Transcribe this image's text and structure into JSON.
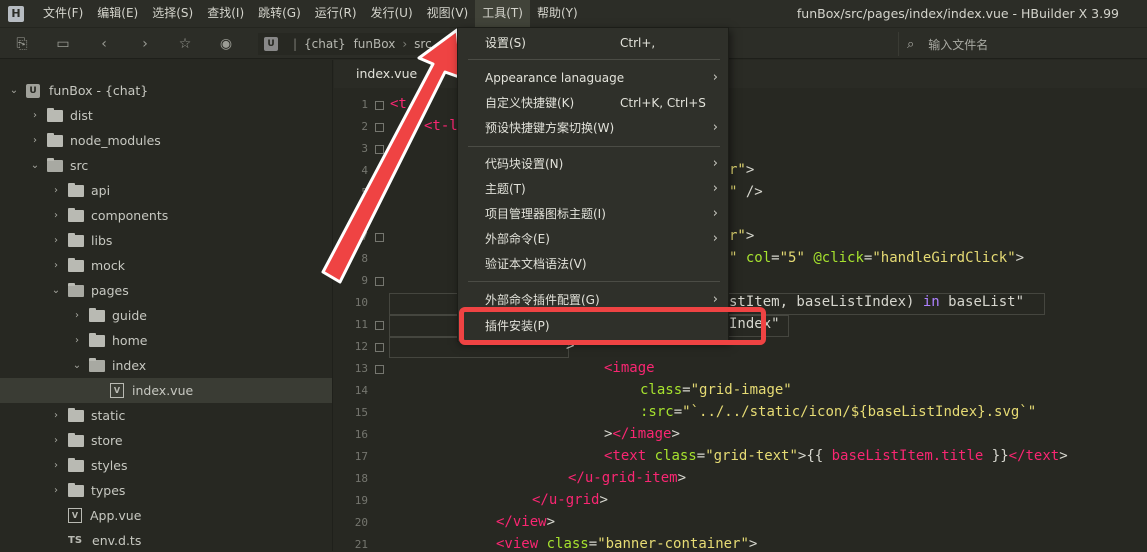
{
  "menubar": {
    "items": [
      "文件(F)",
      "编辑(E)",
      "选择(S)",
      "查找(I)",
      "跳转(G)",
      "运行(R)",
      "发行(U)",
      "视图(V)",
      "工具(T)",
      "帮助(Y)"
    ],
    "active_index": 8,
    "window_title": "funBox/src/pages/index/index.vue - HBuilder X 3.99"
  },
  "toolbar": {
    "breadcrumb": [
      "{chat}",
      "funBox",
      "src"
    ],
    "file_search_placeholder": "输入文件名"
  },
  "sidebar": {
    "project_name": "funBox - {chat}",
    "items": [
      {
        "label": "dist",
        "type": "folder",
        "depth": 1,
        "expanded": false
      },
      {
        "label": "node_modules",
        "type": "folder",
        "depth": 1,
        "expanded": false
      },
      {
        "label": "src",
        "type": "folder",
        "depth": 1,
        "expanded": true
      },
      {
        "label": "api",
        "type": "folder",
        "depth": 2,
        "expanded": false
      },
      {
        "label": "components",
        "type": "folder",
        "depth": 2,
        "expanded": false
      },
      {
        "label": "libs",
        "type": "folder",
        "depth": 2,
        "expanded": false
      },
      {
        "label": "mock",
        "type": "folder",
        "depth": 2,
        "expanded": false
      },
      {
        "label": "pages",
        "type": "folder",
        "depth": 2,
        "expanded": true
      },
      {
        "label": "guide",
        "type": "folder",
        "depth": 3,
        "expanded": false
      },
      {
        "label": "home",
        "type": "folder",
        "depth": 3,
        "expanded": false
      },
      {
        "label": "index",
        "type": "folder",
        "depth": 3,
        "expanded": true
      },
      {
        "label": "index.vue",
        "type": "vue",
        "depth": 4,
        "selected": true
      },
      {
        "label": "static",
        "type": "folder",
        "depth": 2,
        "expanded": false
      },
      {
        "label": "store",
        "type": "folder",
        "depth": 2,
        "expanded": false
      },
      {
        "label": "styles",
        "type": "folder",
        "depth": 2,
        "expanded": false
      },
      {
        "label": "types",
        "type": "folder",
        "depth": 2,
        "expanded": false
      },
      {
        "label": "App.vue",
        "type": "vue",
        "depth": 2
      },
      {
        "label": "env.d.ts",
        "type": "ts",
        "depth": 2
      }
    ]
  },
  "editor": {
    "tab_label": "index.vue",
    "line_numbers": [
      "1",
      "2",
      "3",
      "4",
      "5",
      "6",
      "7",
      "8",
      "9",
      "10",
      "11",
      "12",
      "13",
      "14",
      "15",
      "16",
      "17",
      "18",
      "19",
      "20",
      "21"
    ]
  },
  "tools_menu": {
    "items": [
      {
        "label": "设置(S)",
        "shortcut": "Ctrl+,",
        "submenu": false
      },
      {
        "label": "Appearance lanaguage",
        "shortcut": "",
        "submenu": true
      },
      {
        "label": "自定义快捷键(K)",
        "shortcut": "Ctrl+K, Ctrl+S",
        "submenu": false
      },
      {
        "label": "预设快捷键方案切换(W)",
        "shortcut": "",
        "submenu": true
      },
      {
        "label": "代码块设置(N)",
        "shortcut": "",
        "submenu": true
      },
      {
        "label": "主题(T)",
        "shortcut": "",
        "submenu": true
      },
      {
        "label": "项目管理器图标主题(I)",
        "shortcut": "",
        "submenu": true
      },
      {
        "label": "外部命令(E)",
        "shortcut": "",
        "submenu": true
      },
      {
        "label": "验证本文档语法(V)",
        "shortcut": "",
        "submenu": false
      },
      {
        "label": "外部命令插件配置(G)",
        "shortcut": "",
        "submenu": true
      },
      {
        "label": "插件安装(P)",
        "shortcut": "",
        "submenu": false
      }
    ]
  },
  "annotation": {
    "color": "#ef4343"
  }
}
